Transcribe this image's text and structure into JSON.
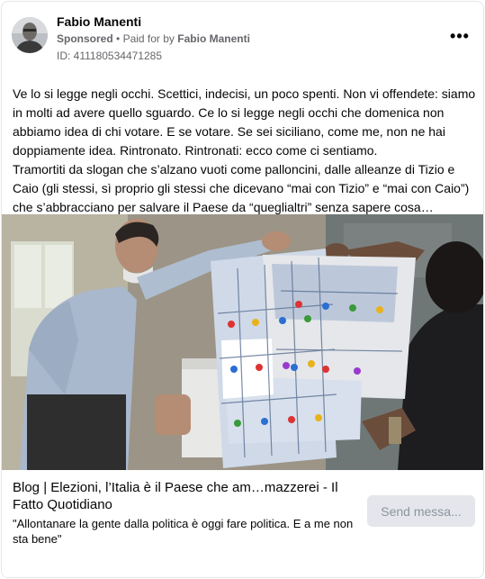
{
  "post": {
    "author": "Fabio Manenti",
    "sponsored": "Sponsored",
    "paid_for_prefix": "Paid for by",
    "paid_for_name": "Fabio Manenti",
    "ad_id": "ID: 411180534471285",
    "more_label": "•••",
    "text_p1": "Ve lo si legge negli occhi. Scettici, indecisi, un poco spenti. Non vi offendete: siamo in molti ad avere quello sguardo. Ce lo si legge negli occhi che domenica non abbiamo idea di chi votare. E se votare. Se sei siciliano, come me, non ne hai doppiamente idea. Rintronato. Rintronati: ecco come ci sentiamo.",
    "text_p2": "Tramortiti da slogan che s’alzano vuoti come palloncini, dalle alleanze di Tizio e Caio (gli stessi, sì proprio gli stessi che dicevano “mai con Tizio” e “mai con Caio”) che s’abbracciano per salvare il Paese da “queglialtri” senza sapere cosa…"
  },
  "link": {
    "title": "Blog | Elezioni, l’Italia è il Paese che am…mazzerei - Il Fatto Quotidiano",
    "description": "\"Allontanare la gente dalla politica è oggi fare politica. E a me non sta bene\"",
    "send_label": "Send messa..."
  },
  "icons": {
    "more": "more-dots-icon"
  }
}
